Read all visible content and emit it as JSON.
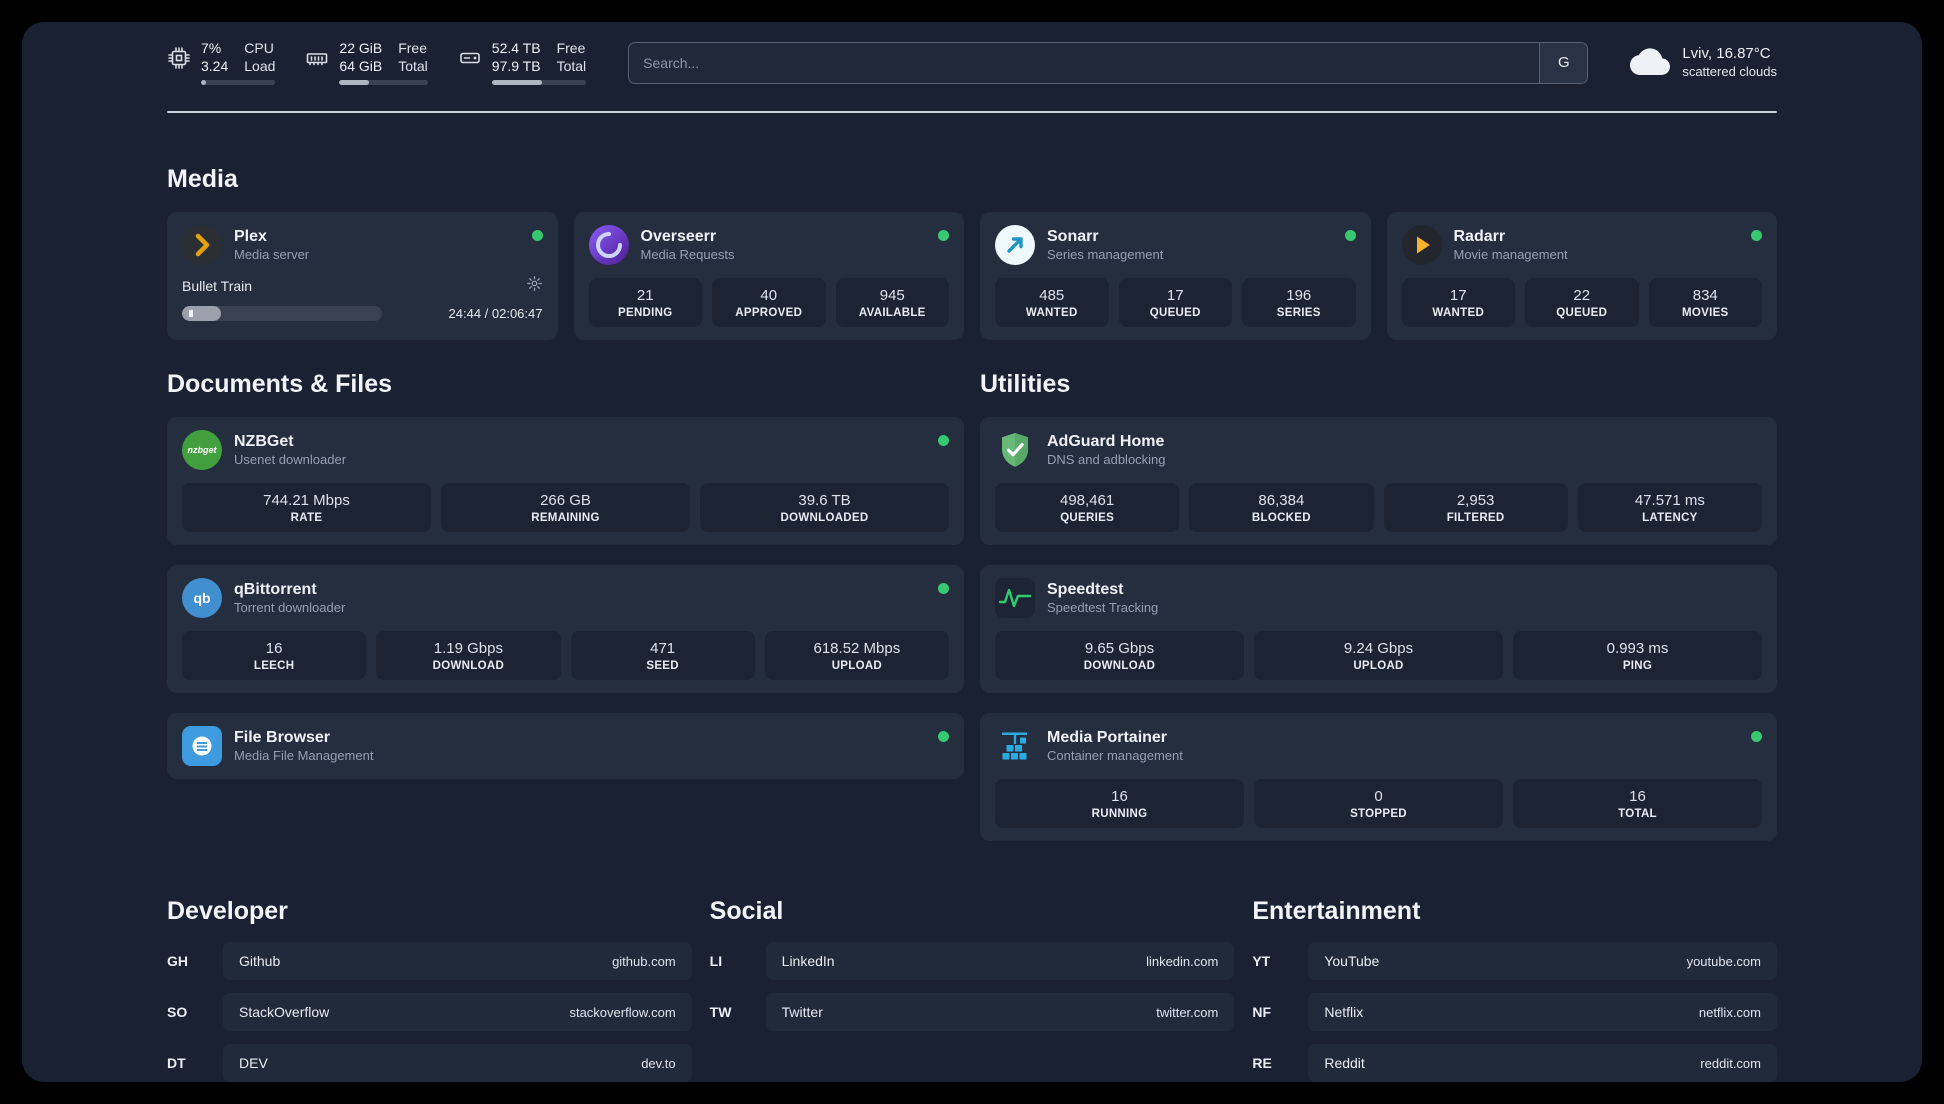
{
  "header": {
    "cpu": {
      "value_top": "7%",
      "value_bottom": "3.24",
      "label_top": "CPU",
      "label_bottom": "Load",
      "progress": 7
    },
    "ram": {
      "value_top": "22 GiB",
      "value_bottom": "64 GiB",
      "label_top": "Free",
      "label_bottom": "Total",
      "progress": 34
    },
    "disk": {
      "value_top": "52.4 TB",
      "value_bottom": "97.9 TB",
      "label_top": "Free",
      "label_bottom": "Total",
      "progress": 53
    },
    "search": {
      "placeholder": "Search...",
      "button_label": "G"
    },
    "weather": {
      "line1": "Lviv, 16.87°C",
      "line2": "scattered clouds"
    }
  },
  "media": {
    "title": "Media",
    "plex": {
      "name": "Plex",
      "subtitle": "Media server",
      "now_playing": "Bullet Train",
      "time": "24:44 / 02:06:47",
      "progress": 19.5
    },
    "overseerr": {
      "name": "Overseerr",
      "subtitle": "Media Requests",
      "stats": [
        {
          "value": "21",
          "label": "PENDING"
        },
        {
          "value": "40",
          "label": "APPROVED"
        },
        {
          "value": "945",
          "label": "AVAILABLE"
        }
      ]
    },
    "sonarr": {
      "name": "Sonarr",
      "subtitle": "Series management",
      "stats": [
        {
          "value": "485",
          "label": "WANTED"
        },
        {
          "value": "17",
          "label": "QUEUED"
        },
        {
          "value": "196",
          "label": "SERIES"
        }
      ]
    },
    "radarr": {
      "name": "Radarr",
      "subtitle": "Movie management",
      "stats": [
        {
          "value": "17",
          "label": "WANTED"
        },
        {
          "value": "22",
          "label": "QUEUED"
        },
        {
          "value": "834",
          "label": "MOVIES"
        }
      ]
    }
  },
  "documents": {
    "title": "Documents & Files",
    "nzbget": {
      "name": "NZBGet",
      "subtitle": "Usenet downloader",
      "stats": [
        {
          "value": "744.21 Mbps",
          "label": "RATE"
        },
        {
          "value": "266 GB",
          "label": "REMAINING"
        },
        {
          "value": "39.6 TB",
          "label": "DOWNLOADED"
        }
      ]
    },
    "qbittorrent": {
      "name": "qBittorrent",
      "subtitle": "Torrent downloader",
      "stats": [
        {
          "value": "16",
          "label": "LEECH"
        },
        {
          "value": "1.19 Gbps",
          "label": "DOWNLOAD"
        },
        {
          "value": "471",
          "label": "SEED"
        },
        {
          "value": "618.52 Mbps",
          "label": "UPLOAD"
        }
      ]
    },
    "filebrowser": {
      "name": "File Browser",
      "subtitle": "Media File Management"
    }
  },
  "utilities": {
    "title": "Utilities",
    "adguard": {
      "name": "AdGuard Home",
      "subtitle": "DNS and adblocking",
      "stats": [
        {
          "value": "498,461",
          "label": "QUERIES"
        },
        {
          "value": "86,384",
          "label": "BLOCKED"
        },
        {
          "value": "2,953",
          "label": "FILTERED"
        },
        {
          "value": "47.571 ms",
          "label": "LATENCY"
        }
      ]
    },
    "speedtest": {
      "name": "Speedtest",
      "subtitle": "Speedtest Tracking",
      "stats": [
        {
          "value": "9.65 Gbps",
          "label": "DOWNLOAD"
        },
        {
          "value": "9.24 Gbps",
          "label": "UPLOAD"
        },
        {
          "value": "0.993 ms",
          "label": "PING"
        }
      ]
    },
    "portainer": {
      "name": "Media Portainer",
      "subtitle": "Container management",
      "stats": [
        {
          "value": "16",
          "label": "RUNNING"
        },
        {
          "value": "0",
          "label": "STOPPED"
        },
        {
          "value": "16",
          "label": "TOTAL"
        }
      ]
    }
  },
  "bookmarks": {
    "developer": {
      "title": "Developer",
      "items": [
        {
          "abbr": "GH",
          "name": "Github",
          "url": "github.com"
        },
        {
          "abbr": "SO",
          "name": "StackOverflow",
          "url": "stackoverflow.com"
        },
        {
          "abbr": "DT",
          "name": "DEV",
          "url": "dev.to"
        }
      ]
    },
    "social": {
      "title": "Social",
      "items": [
        {
          "abbr": "LI",
          "name": "LinkedIn",
          "url": "linkedin.com"
        },
        {
          "abbr": "TW",
          "name": "Twitter",
          "url": "twitter.com"
        }
      ]
    },
    "entertainment": {
      "title": "Entertainment",
      "items": [
        {
          "abbr": "YT",
          "name": "YouTube",
          "url": "youtube.com"
        },
        {
          "abbr": "NF",
          "name": "Netflix",
          "url": "netflix.com"
        },
        {
          "abbr": "RE",
          "name": "Reddit",
          "url": "reddit.com"
        }
      ]
    }
  },
  "colors": {
    "status_online": "#37c871",
    "accent_green": "#2ecc71"
  }
}
